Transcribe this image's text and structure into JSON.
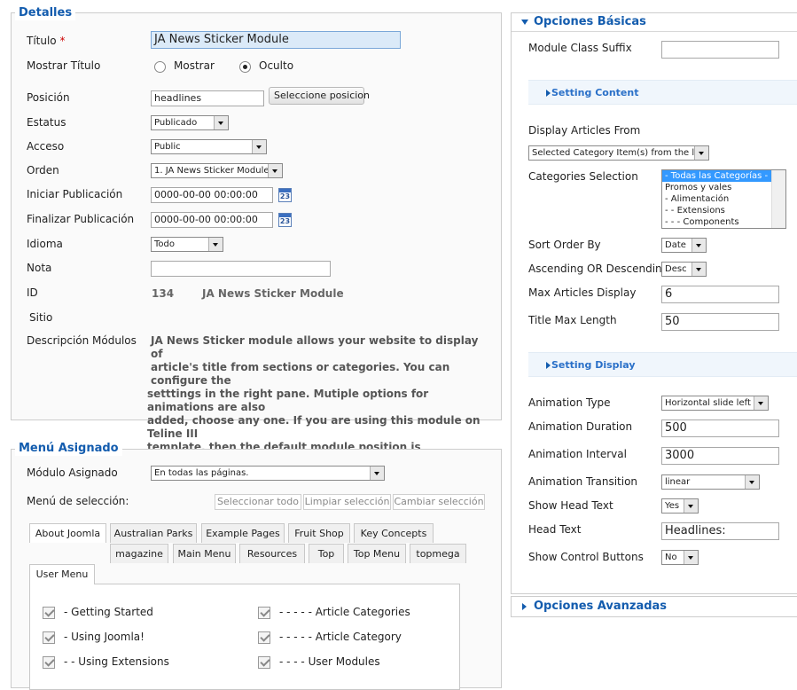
{
  "detalles": {
    "legend": "Detalles",
    "titulo_label": "Título",
    "required_mark": "*",
    "titulo_value": "JA News Sticker Module",
    "mostrar_titulo_label": "Mostrar Título",
    "mostrar_option": "Mostrar",
    "oculto_option": "Oculto",
    "posicion_label": "Posición",
    "posicion_value": "headlines",
    "seleccione_button": "Seleccione posicion",
    "estatus_label": "Estatus",
    "estatus_value": "Publicado",
    "acceso_label": "Acceso",
    "acceso_value": "Public",
    "orden_label": "Orden",
    "orden_value": "1. JA News Sticker Module",
    "iniciar_label": "Iniciar Publicación",
    "iniciar_value": "0000-00-00 00:00:00",
    "finalizar_label": "Finalizar Publicación",
    "finalizar_value": "0000-00-00 00:00:00",
    "calendar_day": "23",
    "idioma_label": "Idioma",
    "idioma_value": "Todo",
    "nota_label": "Nota",
    "nota_value": "",
    "id_label": "ID",
    "id_value": "134",
    "id_name": "JA News Sticker Module",
    "sitio_label": "Sitio",
    "descripcion_label": "Descripción Módulos",
    "descripcion_lines": [
      "JA News Sticker module allows your website to display of",
      "article's title from sections or categories. You can configure the",
      "setttings in the right pane. Mutiple options for animations are also",
      "added, choose any one. If you are using this module on Teline III",
      "template, then the default module position is \"headlines\"."
    ]
  },
  "menu_asignado": {
    "legend": "Menú Asignado",
    "modulo_label": "Módulo Asignado",
    "modulo_value": "En todas las páginas.",
    "seleccion_label": "Menú de selección:",
    "select_all": "Seleccionar todo",
    "clear_selection": "Limpiar selección",
    "toggle_selection": "Cambiar selección",
    "tabs_row1": [
      "About Joomla",
      "Australian Parks",
      "Example Pages",
      "Fruit Shop",
      "Key Concepts"
    ],
    "tabs_row2": [
      "magazine",
      "Main Menu",
      "Resources",
      "Top",
      "Top Menu",
      "topmega"
    ],
    "tabs_row3": [
      "User Menu"
    ],
    "items_left": [
      "- Getting Started",
      "- Using Joomla!",
      "- - Using Extensions"
    ],
    "items_right": [
      "- - - - - Article Categories",
      "- - - - - Article Category",
      "- - - - User Modules"
    ]
  },
  "opciones_basicas": {
    "title": "Opciones Básicas",
    "module_class_suffix_label": "Module Class Suffix",
    "module_class_suffix_value": "",
    "setting_content": "Setting Content",
    "display_articles_label": "Display Articles From",
    "display_articles_value": "Selected Category Item(s) from the list",
    "categories_label": "Categories Selection",
    "categories_options": [
      "- Todas las Categorías -",
      "Promos y vales",
      "- Alimentación",
      "- - Extensions",
      "- - - Components"
    ],
    "sort_order_label": "Sort Order By",
    "sort_order_value": "Date",
    "asc_desc_label": "Ascending OR Descending",
    "asc_desc_value": "Desc",
    "max_articles_label": "Max Articles Display",
    "max_articles_value": "6",
    "title_max_label": "Title Max Length",
    "title_max_value": "50",
    "setting_display": "Setting Display",
    "animation_type_label": "Animation Type",
    "animation_type_value": "Horizontal slide left",
    "animation_duration_label": "Animation Duration",
    "animation_duration_value": "500",
    "animation_interval_label": "Animation Interval",
    "animation_interval_value": "3000",
    "animation_transition_label": "Animation Transition",
    "animation_transition_value": "linear",
    "show_head_text_label": "Show Head Text",
    "show_head_text_value": "Yes",
    "head_text_label": "Head Text",
    "head_text_value": "Headlines:",
    "show_control_label": "Show Control Buttons",
    "show_control_value": "No"
  },
  "opciones_avanzadas": {
    "title": "Opciones Avanzadas"
  }
}
